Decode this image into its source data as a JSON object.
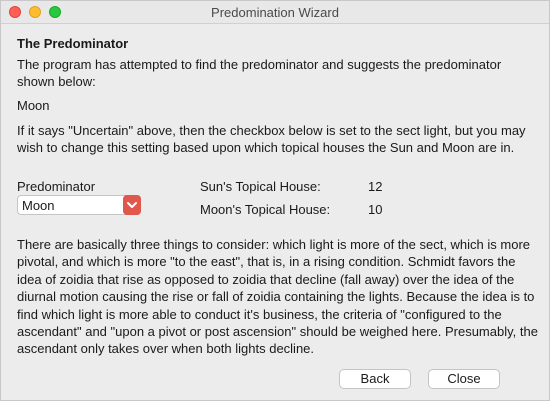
{
  "window": {
    "title": "Predomination Wizard"
  },
  "section": {
    "heading": "The Predominator",
    "intro": "The program has attempted to find the predominator and suggests the predominator shown below:",
    "predominator_value": "Moon",
    "note": "If it says \"Uncertain\" above, then the checkbox below is set to the sect light, but you may wish to change this setting based upon which topical houses the Sun and Moon are in."
  },
  "predominator_field": {
    "label": "Predominator",
    "selected": "Moon"
  },
  "houses": {
    "sun_label": "Sun's Topical House:",
    "sun_value": "12",
    "moon_label": "Moon's Topical House:",
    "moon_value": "10"
  },
  "explanation": "There are basically three things to consider: which light is more of the sect, which is more pivotal, and which is more \"to the east\", that is, in a rising condition.  Schmidt favors the idea of zoidia that rise as opposed to zoidia that decline (fall away) over the idea of the diurnal motion causing the rise or fall of zoidia containing the lights. Because the idea is to find which light is more able to conduct it's business, the criteria of \"configured to the ascendant\" and \"upon a pivot or post ascension\" should be weighed here.  Presumably, the ascendant only takes over when both lights decline.",
  "buttons": {
    "back": "Back",
    "close": "Close"
  }
}
